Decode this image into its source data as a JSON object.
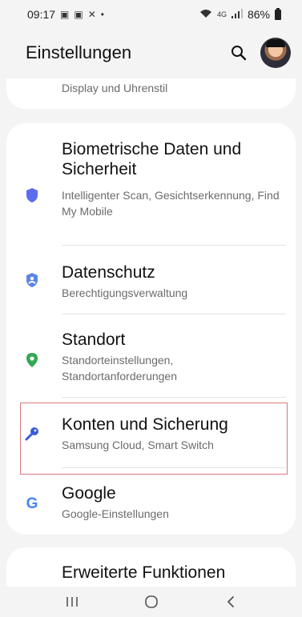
{
  "status": {
    "time": "09:17",
    "battery_pct": "86%",
    "network": "4G"
  },
  "header": {
    "title": "Einstellungen",
    "search_icon": "search-icon"
  },
  "top_card": {
    "subtitle": "Display und Uhrenstil"
  },
  "items": [
    {
      "title": "Biometrische Daten und Sicherheit",
      "subtitle": "Intelligenter Scan, Gesichtserkennung, Find My Mobile",
      "icon": "shield-icon",
      "color": "#5b6cf0"
    },
    {
      "title": "Datenschutz",
      "subtitle": "Berechtigungsverwaltung",
      "icon": "privacy-shield-icon",
      "color": "#5b86e5"
    },
    {
      "title": "Standort",
      "subtitle": "Standorteinstellungen, Standortanforderungen",
      "icon": "location-pin-icon",
      "color": "#34a853"
    },
    {
      "title": "Konten und Sicherung",
      "subtitle": "Samsung Cloud, Smart Switch",
      "icon": "key-icon",
      "color": "#3a5bd9"
    },
    {
      "title": "Google",
      "subtitle": "Google-Einstellungen",
      "icon": "google-icon",
      "color": "#4285f4"
    }
  ],
  "bottom_card": {
    "title": "Erweiterte Funktionen"
  },
  "navbar": {
    "recents_icon": "recent-apps-icon",
    "home_icon": "home-icon",
    "back_icon": "back-icon"
  }
}
